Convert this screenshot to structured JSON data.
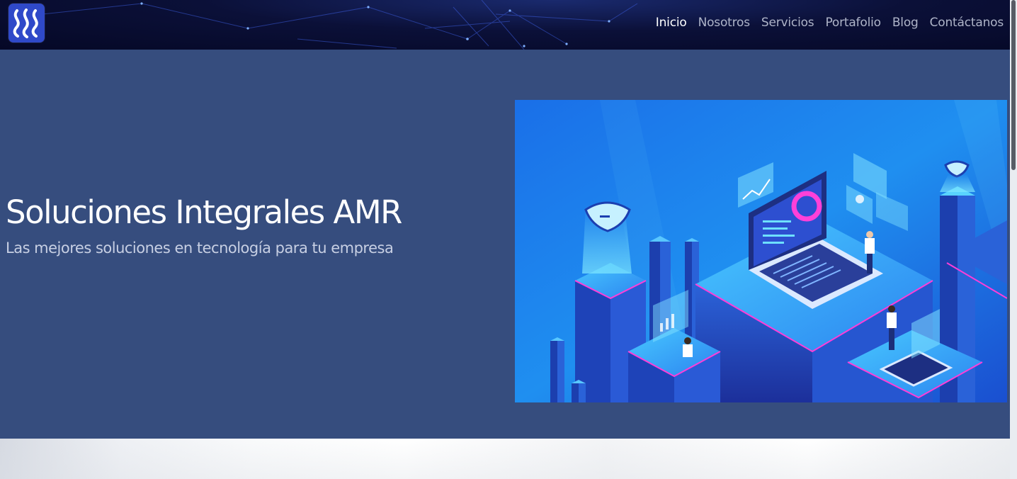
{
  "brand": {
    "logo_icon": "steem-logo-icon",
    "logo_color": "#2f49c9"
  },
  "nav": {
    "items": [
      {
        "label": "Inicio",
        "active": true
      },
      {
        "label": "Nosotros",
        "active": false
      },
      {
        "label": "Servicios",
        "active": false
      },
      {
        "label": "Portafolio",
        "active": false
      },
      {
        "label": "Blog",
        "active": false
      },
      {
        "label": "Contáctanos",
        "active": false
      }
    ]
  },
  "hero": {
    "title": "Soluciones Integrales AMR",
    "subtitle": "Las mejores soluciones en tecnología para tu empresa",
    "background": "#364d7e",
    "illustration": "isometric-tech-illustration"
  }
}
